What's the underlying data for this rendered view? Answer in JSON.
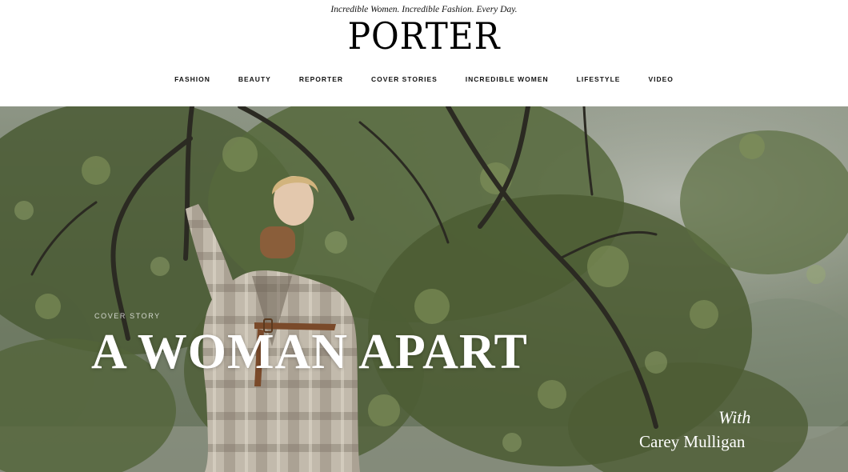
{
  "header": {
    "tagline": "Incredible Women. Incredible Fashion. Every Day.",
    "logo": "PORTER"
  },
  "nav": {
    "items": [
      {
        "label": "FASHION"
      },
      {
        "label": "BEAUTY"
      },
      {
        "label": "REPORTER"
      },
      {
        "label": "COVER STORIES"
      },
      {
        "label": "INCREDIBLE WOMEN"
      },
      {
        "label": "LIFESTYLE"
      },
      {
        "label": "VIDEO"
      }
    ]
  },
  "hero": {
    "eyebrow": "COVER STORY",
    "headline": "A WOMAN APART",
    "with_label": "With",
    "name": "Carey Mulligan"
  },
  "colors": {
    "foliage_dark": "#3f4d2c",
    "foliage_mid": "#6b7d4a",
    "sky": "#a9aea4",
    "coat": "#b9b0a2",
    "belt": "#7a4a2a"
  }
}
